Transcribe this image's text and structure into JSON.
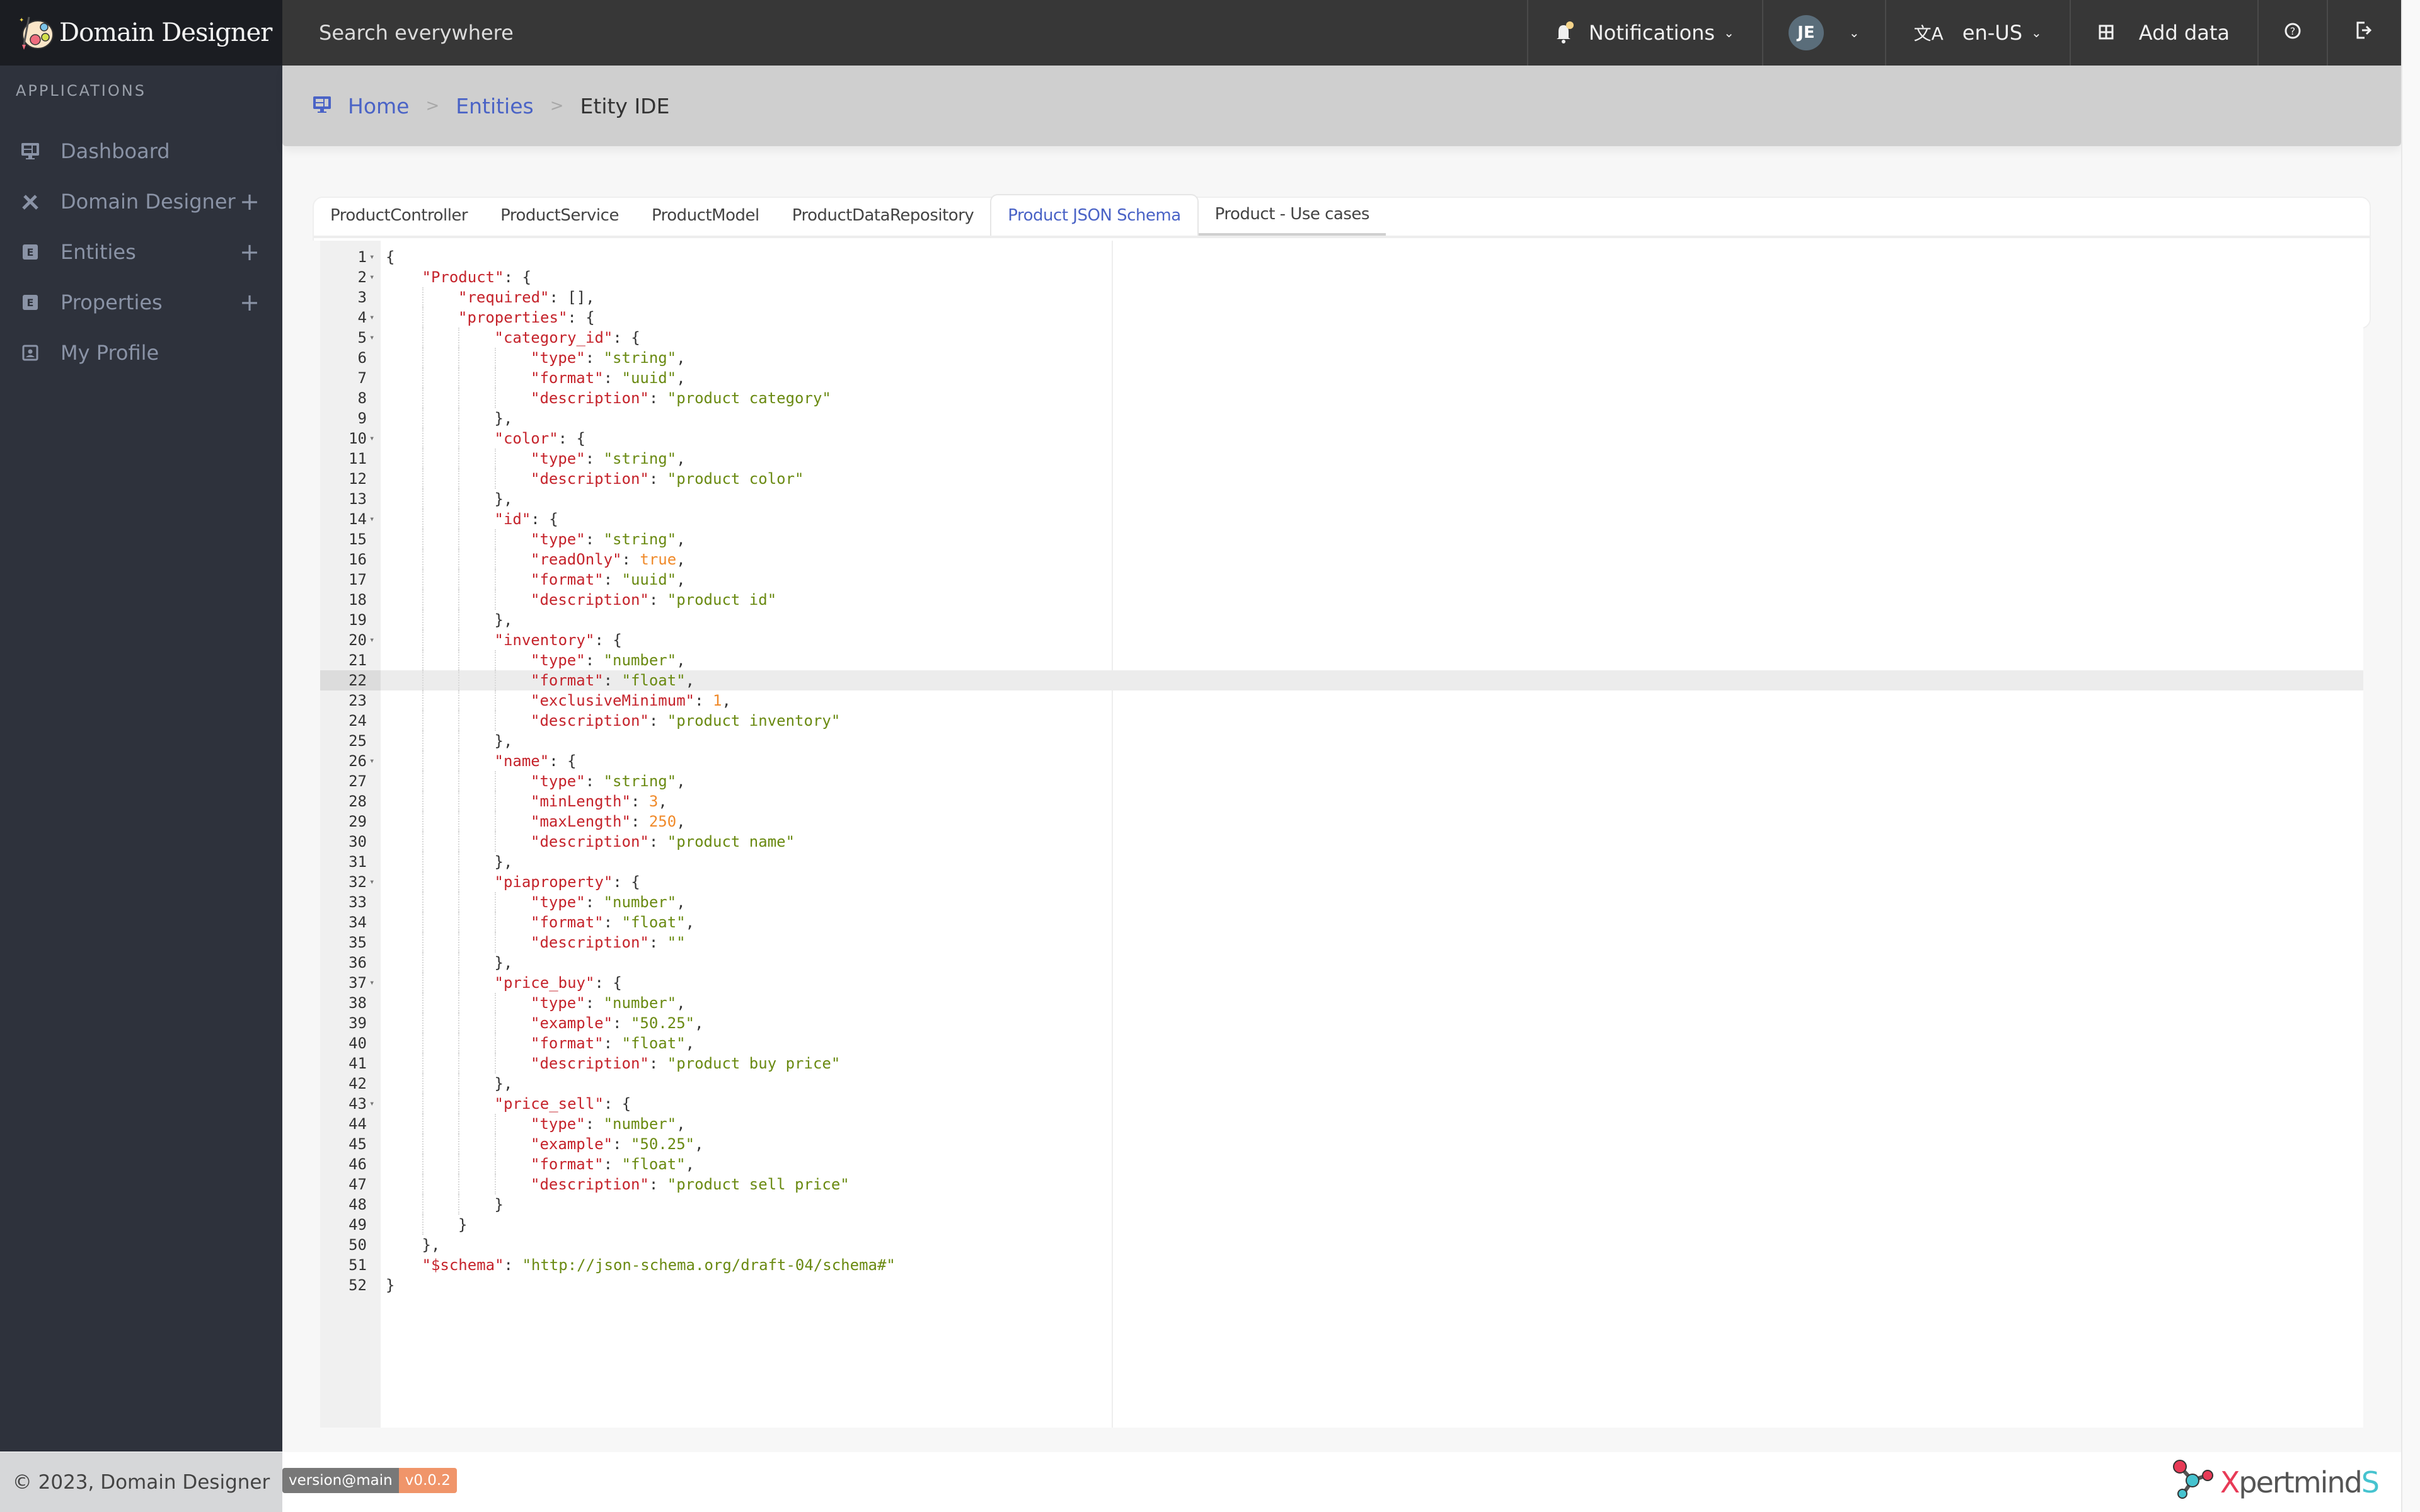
{
  "topbar": {
    "app_name": "Domain Designer",
    "search_placeholder": "Search everywhere",
    "notifications_label": "Notifications",
    "user_initials": "JE",
    "language": "en-US",
    "add_data_label": "Add data",
    "help_icon": "help-circle-icon",
    "logout_icon": "logout-icon"
  },
  "sidebar": {
    "section_title": "APPLICATIONS",
    "items": [
      {
        "label": "Dashboard",
        "icon": "monitor-icon",
        "expandable": false
      },
      {
        "label": "Domain Designer",
        "icon": "design-tools-icon",
        "expandable": true
      },
      {
        "label": "Entities",
        "icon": "entity-icon",
        "expandable": true
      },
      {
        "label": "Properties",
        "icon": "entity-icon",
        "expandable": true
      },
      {
        "label": "My Profile",
        "icon": "profile-icon",
        "expandable": false
      }
    ],
    "expand_symbol": "+"
  },
  "breadcrumb": {
    "items": [
      "Home",
      "Entities"
    ],
    "current": "Etity IDE",
    "separator": ">"
  },
  "tabs": [
    {
      "label": "ProductController",
      "active": false
    },
    {
      "label": "ProductService",
      "active": false
    },
    {
      "label": "ProductModel",
      "active": false
    },
    {
      "label": "ProductDataRepository",
      "active": false
    },
    {
      "label": "Product JSON Schema",
      "active": true
    },
    {
      "label": "Product - Use cases",
      "active": false
    }
  ],
  "editor": {
    "active_line": 22,
    "lines": [
      {
        "n": 1,
        "indent": 0,
        "fold": true,
        "t": [
          [
            "p",
            "{"
          ]
        ]
      },
      {
        "n": 2,
        "indent": 1,
        "fold": true,
        "t": [
          [
            "k",
            "\"Product\""
          ],
          [
            "p",
            ": {"
          ]
        ]
      },
      {
        "n": 3,
        "indent": 2,
        "fold": false,
        "t": [
          [
            "k",
            "\"required\""
          ],
          [
            "p",
            ": [],"
          ]
        ]
      },
      {
        "n": 4,
        "indent": 2,
        "fold": true,
        "t": [
          [
            "k",
            "\"properties\""
          ],
          [
            "p",
            ": {"
          ]
        ]
      },
      {
        "n": 5,
        "indent": 3,
        "fold": true,
        "t": [
          [
            "k",
            "\"category_id\""
          ],
          [
            "p",
            ": {"
          ]
        ]
      },
      {
        "n": 6,
        "indent": 4,
        "fold": false,
        "t": [
          [
            "k",
            "\"type\""
          ],
          [
            "p",
            ": "
          ],
          [
            "s",
            "\"string\""
          ],
          [
            "p",
            ","
          ]
        ]
      },
      {
        "n": 7,
        "indent": 4,
        "fold": false,
        "t": [
          [
            "k",
            "\"format\""
          ],
          [
            "p",
            ": "
          ],
          [
            "s",
            "\"uuid\""
          ],
          [
            "p",
            ","
          ]
        ]
      },
      {
        "n": 8,
        "indent": 4,
        "fold": false,
        "t": [
          [
            "k",
            "\"description\""
          ],
          [
            "p",
            ": "
          ],
          [
            "s",
            "\"product category\""
          ]
        ]
      },
      {
        "n": 9,
        "indent": 3,
        "fold": false,
        "t": [
          [
            "p",
            "},"
          ]
        ]
      },
      {
        "n": 10,
        "indent": 3,
        "fold": true,
        "t": [
          [
            "k",
            "\"color\""
          ],
          [
            "p",
            ": {"
          ]
        ]
      },
      {
        "n": 11,
        "indent": 4,
        "fold": false,
        "t": [
          [
            "k",
            "\"type\""
          ],
          [
            "p",
            ": "
          ],
          [
            "s",
            "\"string\""
          ],
          [
            "p",
            ","
          ]
        ]
      },
      {
        "n": 12,
        "indent": 4,
        "fold": false,
        "t": [
          [
            "k",
            "\"description\""
          ],
          [
            "p",
            ": "
          ],
          [
            "s",
            "\"product color\""
          ]
        ]
      },
      {
        "n": 13,
        "indent": 3,
        "fold": false,
        "t": [
          [
            "p",
            "},"
          ]
        ]
      },
      {
        "n": 14,
        "indent": 3,
        "fold": true,
        "t": [
          [
            "k",
            "\"id\""
          ],
          [
            "p",
            ": {"
          ]
        ]
      },
      {
        "n": 15,
        "indent": 4,
        "fold": false,
        "t": [
          [
            "k",
            "\"type\""
          ],
          [
            "p",
            ": "
          ],
          [
            "s",
            "\"string\""
          ],
          [
            "p",
            ","
          ]
        ]
      },
      {
        "n": 16,
        "indent": 4,
        "fold": false,
        "t": [
          [
            "k",
            "\"readOnly\""
          ],
          [
            "p",
            ": "
          ],
          [
            "n",
            "true"
          ],
          [
            "p",
            ","
          ]
        ]
      },
      {
        "n": 17,
        "indent": 4,
        "fold": false,
        "t": [
          [
            "k",
            "\"format\""
          ],
          [
            "p",
            ": "
          ],
          [
            "s",
            "\"uuid\""
          ],
          [
            "p",
            ","
          ]
        ]
      },
      {
        "n": 18,
        "indent": 4,
        "fold": false,
        "t": [
          [
            "k",
            "\"description\""
          ],
          [
            "p",
            ": "
          ],
          [
            "s",
            "\"product id\""
          ]
        ]
      },
      {
        "n": 19,
        "indent": 3,
        "fold": false,
        "t": [
          [
            "p",
            "},"
          ]
        ]
      },
      {
        "n": 20,
        "indent": 3,
        "fold": true,
        "t": [
          [
            "k",
            "\"inventory\""
          ],
          [
            "p",
            ": {"
          ]
        ]
      },
      {
        "n": 21,
        "indent": 4,
        "fold": false,
        "t": [
          [
            "k",
            "\"type\""
          ],
          [
            "p",
            ": "
          ],
          [
            "s",
            "\"number\""
          ],
          [
            "p",
            ","
          ]
        ]
      },
      {
        "n": 22,
        "indent": 4,
        "fold": false,
        "t": [
          [
            "k",
            "\"format\""
          ],
          [
            "p",
            ": "
          ],
          [
            "s",
            "\"float\""
          ],
          [
            "p",
            ","
          ]
        ]
      },
      {
        "n": 23,
        "indent": 4,
        "fold": false,
        "t": [
          [
            "k",
            "\"exclusiveMinimum\""
          ],
          [
            "p",
            ": "
          ],
          [
            "n",
            "1"
          ],
          [
            "p",
            ","
          ]
        ]
      },
      {
        "n": 24,
        "indent": 4,
        "fold": false,
        "t": [
          [
            "k",
            "\"description\""
          ],
          [
            "p",
            ": "
          ],
          [
            "s",
            "\"product inventory\""
          ]
        ]
      },
      {
        "n": 25,
        "indent": 3,
        "fold": false,
        "t": [
          [
            "p",
            "},"
          ]
        ]
      },
      {
        "n": 26,
        "indent": 3,
        "fold": true,
        "t": [
          [
            "k",
            "\"name\""
          ],
          [
            "p",
            ": {"
          ]
        ]
      },
      {
        "n": 27,
        "indent": 4,
        "fold": false,
        "t": [
          [
            "k",
            "\"type\""
          ],
          [
            "p",
            ": "
          ],
          [
            "s",
            "\"string\""
          ],
          [
            "p",
            ","
          ]
        ]
      },
      {
        "n": 28,
        "indent": 4,
        "fold": false,
        "t": [
          [
            "k",
            "\"minLength\""
          ],
          [
            "p",
            ": "
          ],
          [
            "n",
            "3"
          ],
          [
            "p",
            ","
          ]
        ]
      },
      {
        "n": 29,
        "indent": 4,
        "fold": false,
        "t": [
          [
            "k",
            "\"maxLength\""
          ],
          [
            "p",
            ": "
          ],
          [
            "n",
            "250"
          ],
          [
            "p",
            ","
          ]
        ]
      },
      {
        "n": 30,
        "indent": 4,
        "fold": false,
        "t": [
          [
            "k",
            "\"description\""
          ],
          [
            "p",
            ": "
          ],
          [
            "s",
            "\"product name\""
          ]
        ]
      },
      {
        "n": 31,
        "indent": 3,
        "fold": false,
        "t": [
          [
            "p",
            "},"
          ]
        ]
      },
      {
        "n": 32,
        "indent": 3,
        "fold": true,
        "t": [
          [
            "k",
            "\"piaproperty\""
          ],
          [
            "p",
            ": {"
          ]
        ]
      },
      {
        "n": 33,
        "indent": 4,
        "fold": false,
        "t": [
          [
            "k",
            "\"type\""
          ],
          [
            "p",
            ": "
          ],
          [
            "s",
            "\"number\""
          ],
          [
            "p",
            ","
          ]
        ]
      },
      {
        "n": 34,
        "indent": 4,
        "fold": false,
        "t": [
          [
            "k",
            "\"format\""
          ],
          [
            "p",
            ": "
          ],
          [
            "s",
            "\"float\""
          ],
          [
            "p",
            ","
          ]
        ]
      },
      {
        "n": 35,
        "indent": 4,
        "fold": false,
        "t": [
          [
            "k",
            "\"description\""
          ],
          [
            "p",
            ": "
          ],
          [
            "s",
            "\"\""
          ]
        ]
      },
      {
        "n": 36,
        "indent": 3,
        "fold": false,
        "t": [
          [
            "p",
            "},"
          ]
        ]
      },
      {
        "n": 37,
        "indent": 3,
        "fold": true,
        "t": [
          [
            "k",
            "\"price_buy\""
          ],
          [
            "p",
            ": {"
          ]
        ]
      },
      {
        "n": 38,
        "indent": 4,
        "fold": false,
        "t": [
          [
            "k",
            "\"type\""
          ],
          [
            "p",
            ": "
          ],
          [
            "s",
            "\"number\""
          ],
          [
            "p",
            ","
          ]
        ]
      },
      {
        "n": 39,
        "indent": 4,
        "fold": false,
        "t": [
          [
            "k",
            "\"example\""
          ],
          [
            "p",
            ": "
          ],
          [
            "s",
            "\"50.25\""
          ],
          [
            "p",
            ","
          ]
        ]
      },
      {
        "n": 40,
        "indent": 4,
        "fold": false,
        "t": [
          [
            "k",
            "\"format\""
          ],
          [
            "p",
            ": "
          ],
          [
            "s",
            "\"float\""
          ],
          [
            "p",
            ","
          ]
        ]
      },
      {
        "n": 41,
        "indent": 4,
        "fold": false,
        "t": [
          [
            "k",
            "\"description\""
          ],
          [
            "p",
            ": "
          ],
          [
            "s",
            "\"product buy price\""
          ]
        ]
      },
      {
        "n": 42,
        "indent": 3,
        "fold": false,
        "t": [
          [
            "p",
            "},"
          ]
        ]
      },
      {
        "n": 43,
        "indent": 3,
        "fold": true,
        "t": [
          [
            "k",
            "\"price_sell\""
          ],
          [
            "p",
            ": {"
          ]
        ]
      },
      {
        "n": 44,
        "indent": 4,
        "fold": false,
        "t": [
          [
            "k",
            "\"type\""
          ],
          [
            "p",
            ": "
          ],
          [
            "s",
            "\"number\""
          ],
          [
            "p",
            ","
          ]
        ]
      },
      {
        "n": 45,
        "indent": 4,
        "fold": false,
        "t": [
          [
            "k",
            "\"example\""
          ],
          [
            "p",
            ": "
          ],
          [
            "s",
            "\"50.25\""
          ],
          [
            "p",
            ","
          ]
        ]
      },
      {
        "n": 46,
        "indent": 4,
        "fold": false,
        "t": [
          [
            "k",
            "\"format\""
          ],
          [
            "p",
            ": "
          ],
          [
            "s",
            "\"float\""
          ],
          [
            "p",
            ","
          ]
        ]
      },
      {
        "n": 47,
        "indent": 4,
        "fold": false,
        "t": [
          [
            "k",
            "\"description\""
          ],
          [
            "p",
            ": "
          ],
          [
            "s",
            "\"product sell price\""
          ]
        ]
      },
      {
        "n": 48,
        "indent": 3,
        "fold": false,
        "t": [
          [
            "p",
            "}"
          ]
        ]
      },
      {
        "n": 49,
        "indent": 2,
        "fold": false,
        "t": [
          [
            "p",
            "}"
          ]
        ]
      },
      {
        "n": 50,
        "indent": 1,
        "fold": false,
        "t": [
          [
            "p",
            "},"
          ]
        ]
      },
      {
        "n": 51,
        "indent": 1,
        "fold": false,
        "t": [
          [
            "k",
            "\"$schema\""
          ],
          [
            "p",
            ": "
          ],
          [
            "s",
            "\"http://json-schema.org/draft-04/schema#\""
          ]
        ]
      },
      {
        "n": 52,
        "indent": 0,
        "fold": false,
        "t": [
          [
            "p",
            "}"
          ]
        ]
      }
    ]
  },
  "footer": {
    "copyright": "© 2023, Domain Designer",
    "version_label": "version@main",
    "version_value": "v0.0.2",
    "company_x": "X",
    "company_mid": "pertmind",
    "company_s": "S"
  },
  "colors": {
    "accent": "#4a63c6",
    "json_key": "#c5232b",
    "json_string": "#6a8a12",
    "json_number": "#f08a2a",
    "sidebar_bg": "#2e323c",
    "topbar_bg": "#373737"
  }
}
